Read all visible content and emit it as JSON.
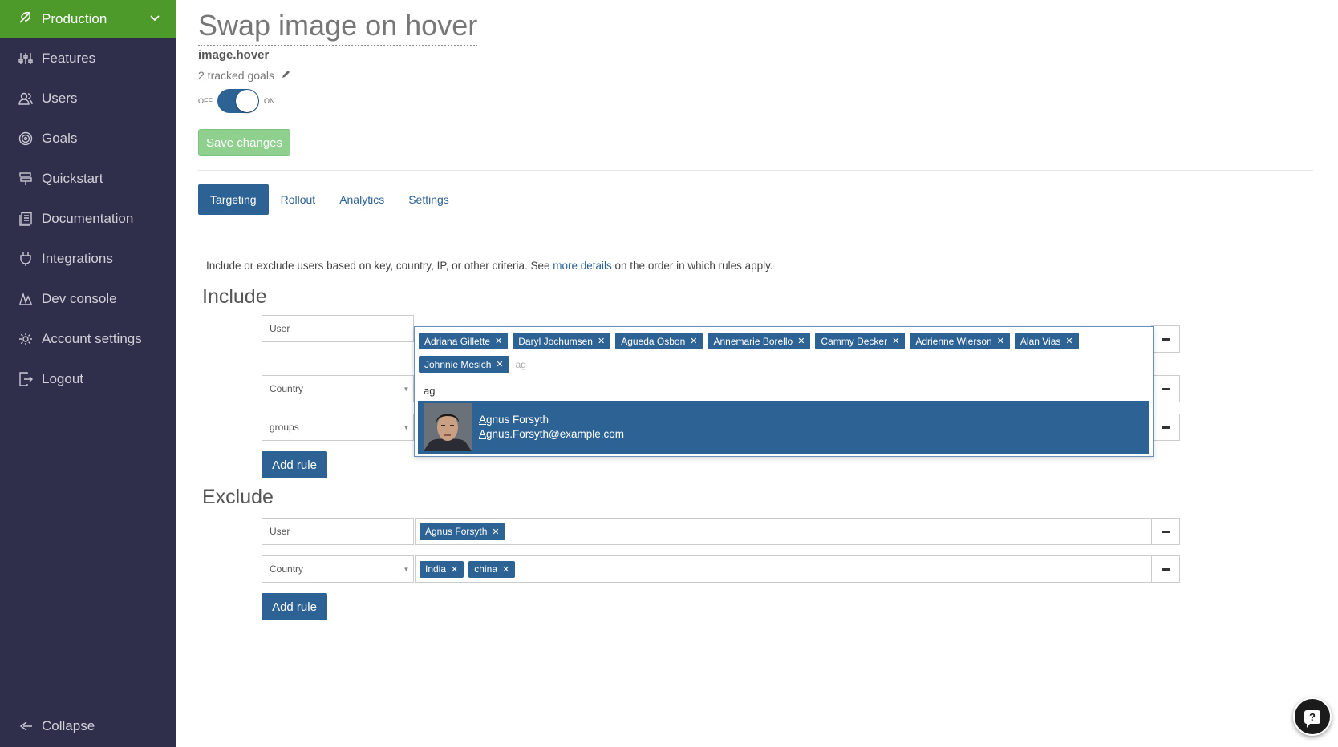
{
  "sidebar": {
    "environment": "Production",
    "items": [
      {
        "label": "Features",
        "icon": "sliders-icon"
      },
      {
        "label": "Users",
        "icon": "users-icon"
      },
      {
        "label": "Goals",
        "icon": "target-icon"
      },
      {
        "label": "Quickstart",
        "icon": "signpost-icon"
      },
      {
        "label": "Documentation",
        "icon": "book-icon"
      },
      {
        "label": "Integrations",
        "icon": "plug-icon"
      },
      {
        "label": "Dev console",
        "icon": "pulse-icon"
      },
      {
        "label": "Account settings",
        "icon": "gear-icon"
      },
      {
        "label": "Logout",
        "icon": "logout-icon"
      }
    ],
    "collapse": "Collapse"
  },
  "header": {
    "title": "Swap image on hover",
    "key": "image.hover",
    "goals": "2 tracked goals",
    "toggle_off": "OFF",
    "toggle_on": "ON",
    "save_label": "Save changes"
  },
  "tabs": [
    "Targeting",
    "Rollout",
    "Analytics",
    "Settings"
  ],
  "intro": {
    "before": "Include or exclude users based on key, country, IP, or other criteria. See ",
    "link": "more details",
    "after": " on the order in which rules apply."
  },
  "include": {
    "heading": "Include",
    "rules": [
      {
        "attribute": "User"
      },
      {
        "attribute": "Country"
      },
      {
        "attribute": "groups"
      }
    ],
    "user_tags": [
      "Adriana Gillette",
      "Daryl Jochumsen",
      "Agueda Osbon",
      "Annemarie Borello",
      "Cammy Decker",
      "Adrienne Wierson",
      "Alan Vias",
      "Johnnie Mesich"
    ],
    "typed": "ag",
    "search": "ag",
    "option": {
      "name_hl": "A",
      "name_rest": "gnus Forsyth",
      "email_hl": "A",
      "email_rest": "gnus.Forsyth@example.com"
    },
    "add_rule": "Add rule"
  },
  "exclude": {
    "heading": "Exclude",
    "rules": [
      {
        "attribute": "User",
        "tags": [
          "Agnus Forsyth"
        ]
      },
      {
        "attribute": "Country",
        "tags": [
          "India",
          "china"
        ]
      }
    ],
    "add_rule": "Add rule"
  },
  "colors": {
    "sidebar": "#302f4b",
    "env": "#4d9a2a",
    "accent": "#2d6295",
    "save": "#8fd08f"
  }
}
